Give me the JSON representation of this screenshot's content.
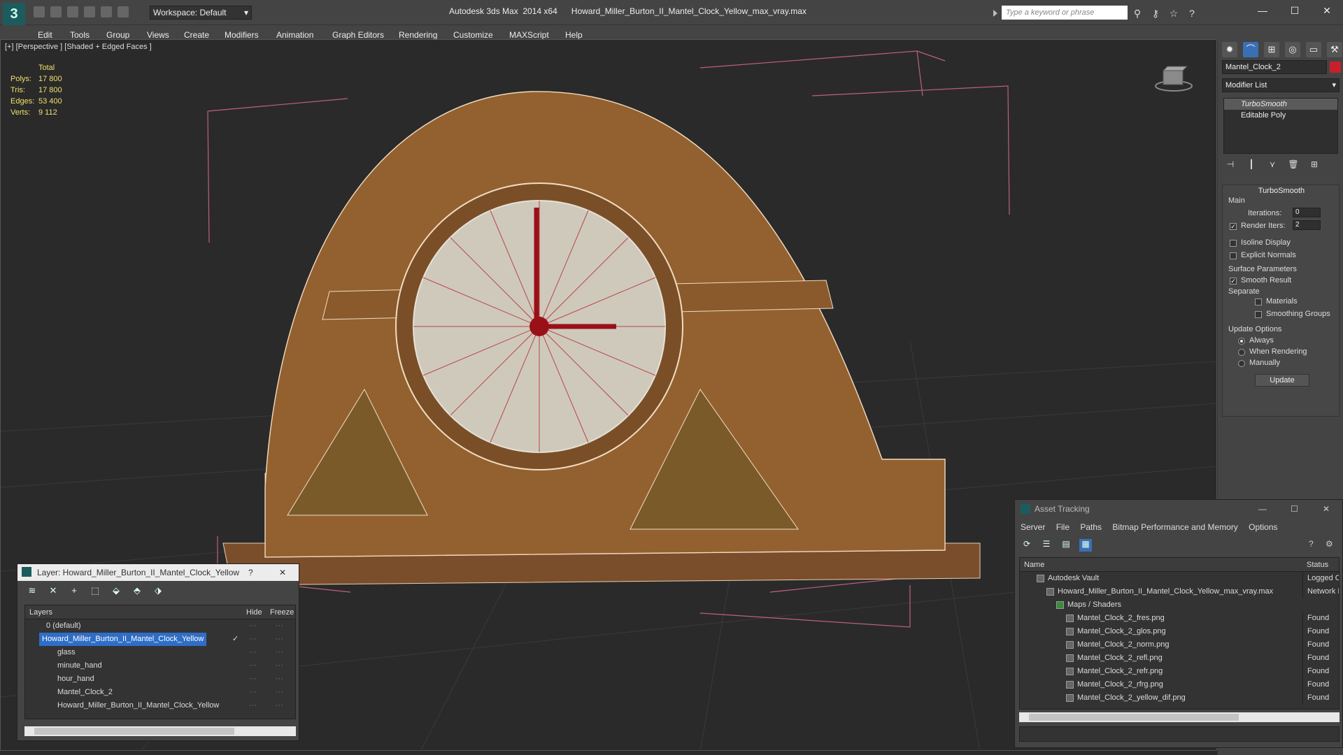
{
  "titlebar": {
    "app_logo": "3",
    "workspace": "Workspace: Default",
    "app_name": "Autodesk 3ds Max  2014 x64",
    "file_name": "Howard_Miller_Burton_II_Mantel_Clock_Yellow_max_vray.max",
    "search_placeholder": "Type a keyword or phrase",
    "win_min": "—",
    "win_max": "☐",
    "win_close": "✕"
  },
  "menu": [
    "Edit",
    "Tools",
    "Group",
    "Views",
    "Create",
    "Modifiers",
    "Animation",
    "Graph Editors",
    "Rendering",
    "Customize",
    "MAXScript",
    "Help"
  ],
  "viewport": {
    "label": "[+] [Perspective ] [Shaded + Edged Faces ]",
    "stats": {
      "header": "Total",
      "rows": [
        {
          "k": "Polys:",
          "v": "17 800"
        },
        {
          "k": "Tris:",
          "v": "17 800"
        },
        {
          "k": "Edges:",
          "v": "53 400"
        },
        {
          "k": "Verts:",
          "v": "9 112"
        }
      ]
    }
  },
  "command_panel": {
    "object_name": "Mantel_Clock_2",
    "object_color": "#c8202a",
    "modifier_list": "Modifier List",
    "stack": [
      "TurboSmooth",
      "Editable Poly"
    ],
    "rollout_title": "TurboSmooth",
    "main_label": "Main",
    "iterations_label": "Iterations:",
    "iterations_value": "0",
    "render_iters_label": "Render Iters:",
    "render_iters_value": "2",
    "isoline": "Isoline Display",
    "explicit_normals": "Explicit Normals",
    "surface_params": "Surface Parameters",
    "smooth_result": "Smooth Result",
    "separate": "Separate",
    "materials": "Materials",
    "smoothing_groups": "Smoothing Groups",
    "update_options": "Update Options",
    "always": "Always",
    "when_rendering": "When Rendering",
    "manually": "Manually",
    "update_button": "Update"
  },
  "layer_window": {
    "title": "Layer: Howard_Miller_Burton_II_Mantel_Clock_Yellow",
    "help": "?",
    "close": "✕",
    "col_layers": "Layers",
    "col_hide": "Hide",
    "col_freeze": "Freeze",
    "rows": [
      {
        "name": "0 (default)",
        "indent": 0
      },
      {
        "name": "Howard_Miller_Burton_II_Mantel_Clock_Yellow",
        "indent": 0
      },
      {
        "name": "glass",
        "indent": 1
      },
      {
        "name": "minute_hand",
        "indent": 1
      },
      {
        "name": "hour_hand",
        "indent": 1
      },
      {
        "name": "Mantel_Clock_2",
        "indent": 1
      },
      {
        "name": "Howard_Miller_Burton_II_Mantel_Clock_Yellow",
        "indent": 1
      }
    ]
  },
  "asset_window": {
    "title": "Asset Tracking",
    "menu": [
      "Server",
      "File",
      "Paths",
      "Bitmap Performance and Memory",
      "Options"
    ],
    "col_name": "Name",
    "col_status": "Status",
    "rows": [
      {
        "name": "Autodesk Vault",
        "status": "Logged O",
        "indent": 0
      },
      {
        "name": "Howard_Miller_Burton_II_Mantel_Clock_Yellow_max_vray.max",
        "status": "Network I",
        "indent": 1
      },
      {
        "name": "Maps / Shaders",
        "status": "",
        "indent": 2
      },
      {
        "name": "Mantel_Clock_2_fres.png",
        "status": "Found",
        "indent": 3
      },
      {
        "name": "Mantel_Clock_2_glos.png",
        "status": "Found",
        "indent": 3
      },
      {
        "name": "Mantel_Clock_2_norm.png",
        "status": "Found",
        "indent": 3
      },
      {
        "name": "Mantel_Clock_2_refl.png",
        "status": "Found",
        "indent": 3
      },
      {
        "name": "Mantel_Clock_2_refr.png",
        "status": "Found",
        "indent": 3
      },
      {
        "name": "Mantel_Clock_2_rfrg.png",
        "status": "Found",
        "indent": 3
      },
      {
        "name": "Mantel_Clock_2_yellow_dif.png",
        "status": "Found",
        "indent": 3
      }
    ]
  }
}
